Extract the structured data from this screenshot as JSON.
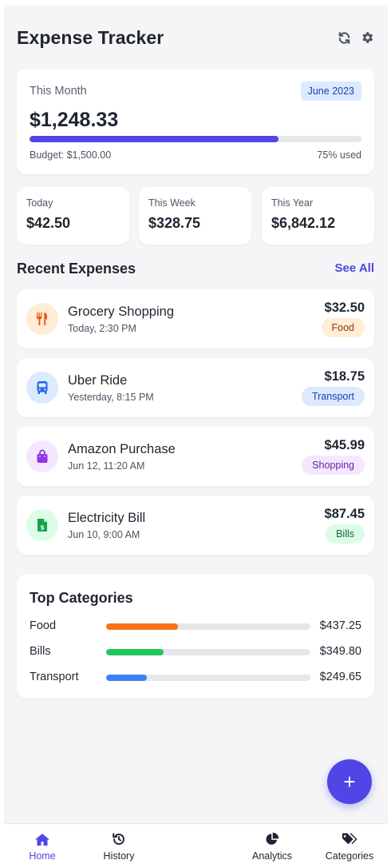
{
  "header": {
    "title": "Expense Tracker",
    "refresh_icon": "refresh-icon",
    "settings_icon": "gear-icon"
  },
  "month": {
    "label": "This Month",
    "badge": "June 2023",
    "amount": "$1,248.33",
    "budget_label": "Budget: $1,500.00",
    "used_label": "75% used",
    "used_fraction": 0.75
  },
  "stats": [
    {
      "label": "Today",
      "value": "$42.50"
    },
    {
      "label": "This Week",
      "value": "$328.75"
    },
    {
      "label": "This Year",
      "value": "$6,842.12"
    }
  ],
  "recent": {
    "title": "Recent Expenses",
    "see_all": "See All",
    "items": [
      {
        "name": "Grocery Shopping",
        "time": "Today, 2:30 PM",
        "amount": "$32.50",
        "category": "Food",
        "icon": "utensils-icon",
        "icon_color": "#ea580c",
        "icon_bg": "#ffedd5",
        "badge_color": "#9a3412",
        "badge_bg": "#ffedd5"
      },
      {
        "name": "Uber Ride",
        "time": "Yesterday, 8:15 PM",
        "amount": "$18.75",
        "category": "Transport",
        "icon": "bus-icon",
        "icon_color": "#2563eb",
        "icon_bg": "#dbeafe",
        "badge_color": "#1e40af",
        "badge_bg": "#dbeafe"
      },
      {
        "name": "Amazon Purchase",
        "time": "Jun 12, 11:20 AM",
        "amount": "$45.99",
        "category": "Shopping",
        "icon": "shopping-bag-icon",
        "icon_color": "#9333ea",
        "icon_bg": "#f3e8ff",
        "badge_color": "#6b21a8",
        "badge_bg": "#f3e8ff"
      },
      {
        "name": "Electricity Bill",
        "time": "Jun 10, 9:00 AM",
        "amount": "$87.45",
        "category": "Bills",
        "icon": "invoice-dollar-icon",
        "icon_color": "#16a34a",
        "icon_bg": "#dcfce7",
        "badge_color": "#166534",
        "badge_bg": "#dcfce7"
      }
    ]
  },
  "categories": {
    "title": "Top Categories",
    "items": [
      {
        "name": "Food",
        "amount": "$437.25",
        "fraction": 0.35,
        "color": "#f97316"
      },
      {
        "name": "Bills",
        "amount": "$349.80",
        "fraction": 0.28,
        "color": "#22c55e"
      },
      {
        "name": "Transport",
        "amount": "$249.65",
        "fraction": 0.2,
        "color": "#3b82f6"
      }
    ]
  },
  "fab": {
    "label": "+"
  },
  "nav": [
    {
      "label": "Home",
      "icon": "home-icon",
      "active": true
    },
    {
      "label": "History",
      "icon": "history-icon",
      "active": false
    },
    {
      "label": "Analytics",
      "icon": "pie-chart-icon",
      "active": false
    },
    {
      "label": "Categories",
      "icon": "tags-icon",
      "active": false
    }
  ],
  "colors": {
    "accent": "#4f46e5",
    "text": "#1f2530",
    "muted": "#4b5563"
  }
}
